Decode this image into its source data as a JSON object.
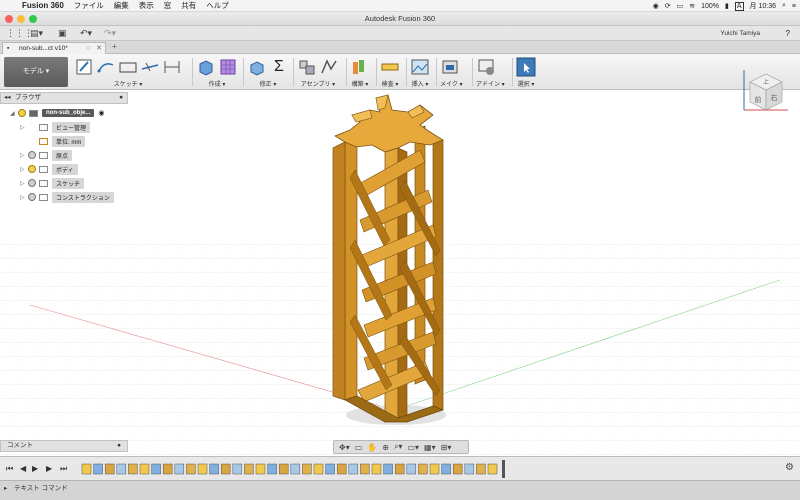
{
  "menubar": {
    "app": "Fusion 360",
    "items": [
      "ファイル",
      "編集",
      "表示",
      "窓",
      "共有",
      "ヘルプ"
    ],
    "battery": "100%",
    "input": "A",
    "clock": "月 10:36"
  },
  "window": {
    "title": "Autodesk Fusion 360"
  },
  "qat": {
    "user": "Yuichi Tamiya",
    "help": "?"
  },
  "tab": {
    "label": "non-sub...ct v10*"
  },
  "ribbon": {
    "workspace": "モデル",
    "groups": [
      "スケッチ",
      "作成",
      "修正",
      "アセンブリ",
      "構築",
      "検査",
      "挿入",
      "メイク",
      "アドイン",
      "選択"
    ]
  },
  "browser": {
    "title": "ブラウザ",
    "root": "non-sub_obje...",
    "items": [
      "ビュー管理",
      "単位: mm",
      "原点",
      "ボディ",
      "スケッチ",
      "コンストラクション"
    ]
  },
  "comment": {
    "label": "コメント"
  },
  "textcmd": {
    "label": "テキスト コマンド"
  },
  "viewcube": {
    "top": "上",
    "front": "前",
    "right": "右"
  },
  "colors": {
    "model": "#e0a031",
    "model_dark": "#9a6a14",
    "workspace": "#666666",
    "accent": "#2b6cb0"
  }
}
